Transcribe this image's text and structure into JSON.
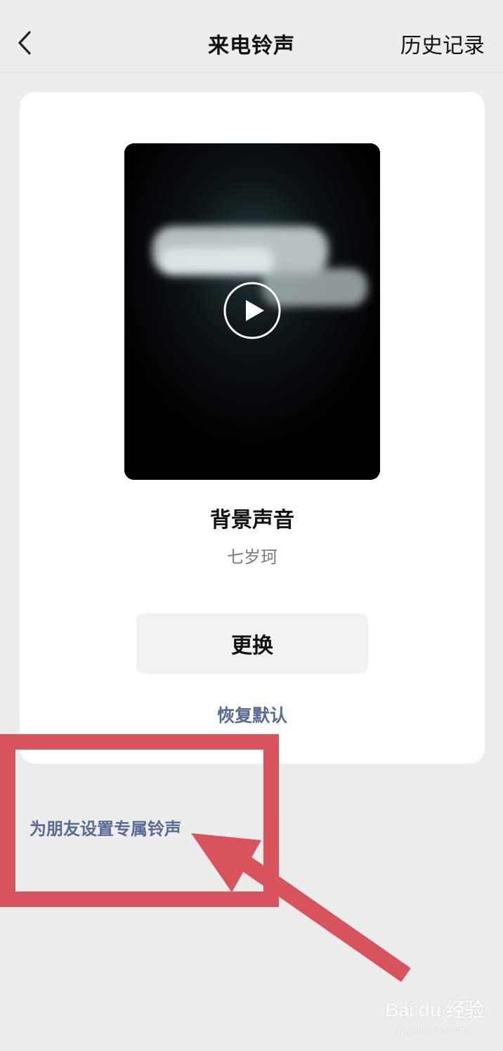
{
  "header": {
    "title": "来电铃声",
    "history_label": "历史记录",
    "back_icon": "chevron-left-icon"
  },
  "ringtone": {
    "title": "背景声音",
    "artist": "七岁珂",
    "play_icon": "play-icon",
    "change_label": "更换",
    "restore_label": "恢复默认"
  },
  "friend_setting": {
    "label": "为朋友设置专属铃声"
  },
  "colors": {
    "background": "#ededed",
    "card": "#ffffff",
    "link_blue": "#576b95",
    "annotation_red": "#d9535d"
  },
  "watermark": {
    "logo": "Bai du 经验",
    "url": "jingyan.baidu.com"
  }
}
